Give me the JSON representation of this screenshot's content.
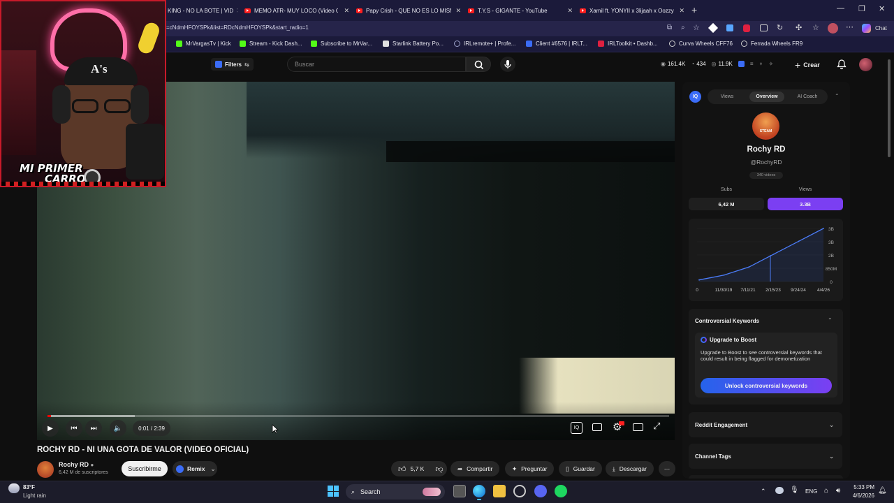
{
  "browser": {
    "tabs": [
      {
        "label": "KING - NO LA BOTE | VID"
      },
      {
        "label": "MEMO ATR- MUY LOCO (Video O"
      },
      {
        "label": "Papy Crish - QUE NO ES LO MISM"
      },
      {
        "label": "T.Y.S - GIGANTE - YouTube"
      },
      {
        "label": "Xamil ft. YONYII x 3lijaah x Oozzy"
      }
    ],
    "url": "=cNdmHFOYSPk&list=RDcNdmHFOYSPk&start_radio=1",
    "chat_label": "Chat",
    "bookmarks": [
      {
        "label": "MrVargasTv | Kick",
        "color": "#53fc18"
      },
      {
        "label": "Stream - Kick Dash...",
        "color": "#53fc18"
      },
      {
        "label": "Subscribe to MrVar...",
        "color": "#53fc18"
      },
      {
        "label": "Starlink Battery Po...",
        "color": "#e0e0e0"
      },
      {
        "label": "IRLremote+ | Profe...",
        "color": "#9aa0c8"
      },
      {
        "label": "Client #6576 | IRLT...",
        "color": "#3b6cf6"
      },
      {
        "label": "IRLToolkit • Dashb...",
        "color": "#e02040"
      },
      {
        "label": "Curva Wheels CFF76",
        "color": "#cccccc"
      },
      {
        "label": "Ferrada Wheels FR9",
        "color": "#cccccc"
      }
    ]
  },
  "youtube": {
    "filters_label": "Filters",
    "search_placeholder": "Buscar",
    "stats": {
      "views": "161.4K",
      "likes": "434",
      "subs": "11.9K"
    },
    "create_label": "Crear"
  },
  "webcam": {
    "caption_line1": "MI PRIMER",
    "caption_line2": "CARRO"
  },
  "player": {
    "time": "0:01 / 2:39",
    "progress_fraction": 0.006
  },
  "video": {
    "title": "ROCHY RD - NI UNA GOTA DE VALOR (VIDEO OFICIAL)",
    "channel": "Rochy RD",
    "subscribers": "6,42 M de suscriptores",
    "subscribe_label": "Suscribirme",
    "remix_label": "Remix",
    "likes": "5,7 K",
    "share_label": "Compartir",
    "ask_label": "Preguntar",
    "save_label": "Guardar",
    "download_label": "Descargar"
  },
  "panel": {
    "tabs": [
      "Views",
      "Overview",
      "AI Coach"
    ],
    "active_tab": "Overview",
    "avatar_text": "STEAM",
    "channel_name": "Rochy RD",
    "handle": "@RochyRD",
    "videos": "340 videos",
    "subs_label": "Subs",
    "views_label": "Views",
    "subs_value": "6,42 M",
    "views_value": "3.3B",
    "accent": "#7b3ff2",
    "chart_data": {
      "type": "line",
      "x": [
        "11/30/19",
        "7/11/21",
        "2/15/23",
        "9/24/24",
        "4/4/26"
      ],
      "x_first_tick": "0",
      "y_ticks": [
        "3B",
        "3B",
        "2B",
        "850M",
        "0"
      ],
      "series": [
        {
          "values": [
            0.1,
            0.4,
            0.9,
            1.7,
            2.5,
            3.3
          ]
        }
      ],
      "ylim": [
        0,
        3.3
      ]
    },
    "controversial": {
      "header": "Controversial Keywords",
      "upgrade_title": "Upgrade to Boost",
      "upgrade_text": "Upgrade to Boost to see controversial keywords that could result in being flagged for demonetization",
      "button": "Unlock controversial keywords"
    },
    "reddit_label": "Reddit Engagement",
    "tags_label": "Channel Tags"
  },
  "taskbar": {
    "weather_temp": "83°F",
    "weather_desc": "Light rain",
    "search_label": "Search",
    "lang": "ENG",
    "time": "5:33 PM",
    "date": "4/6/2026"
  }
}
